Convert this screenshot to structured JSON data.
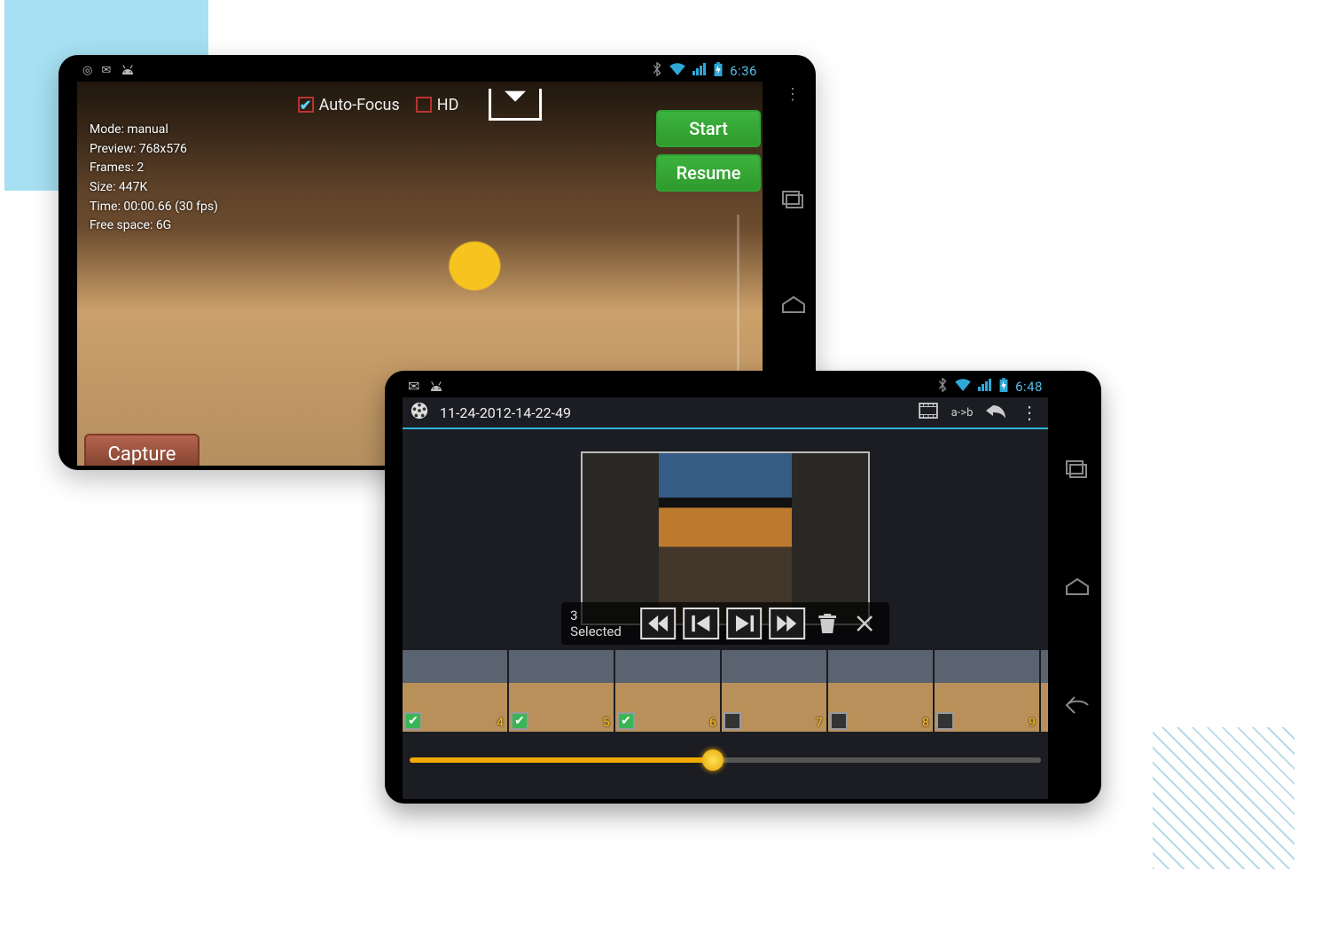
{
  "phone1": {
    "status": {
      "time": "6:36"
    },
    "settings": {
      "autofocus": {
        "label": "Auto-Focus",
        "checked": true
      },
      "hd": {
        "label": "HD",
        "checked": false
      }
    },
    "info": {
      "mode": "Mode: manual",
      "preview": "Preview: 768x576",
      "frames": "Frames: 2",
      "size": "Size: 447K",
      "time": "Time: 00:00.66 (30 fps)",
      "free_space": "Free space: 6G"
    },
    "buttons": {
      "start": "Start",
      "resume": "Resume",
      "capture": "Capture"
    }
  },
  "phone2": {
    "status": {
      "time": "6:48"
    },
    "appbar": {
      "title": "11-24-2012-14-22-49",
      "ab_label": "a->b"
    },
    "controls": {
      "selected_label": "3 Selected"
    },
    "thumbs": [
      {
        "n": "4",
        "checked": true
      },
      {
        "n": "5",
        "checked": true
      },
      {
        "n": "6",
        "checked": true
      },
      {
        "n": "7",
        "checked": false
      },
      {
        "n": "8",
        "checked": false
      },
      {
        "n": "9",
        "checked": false
      }
    ],
    "timeline": {
      "position_pct": 48
    }
  }
}
